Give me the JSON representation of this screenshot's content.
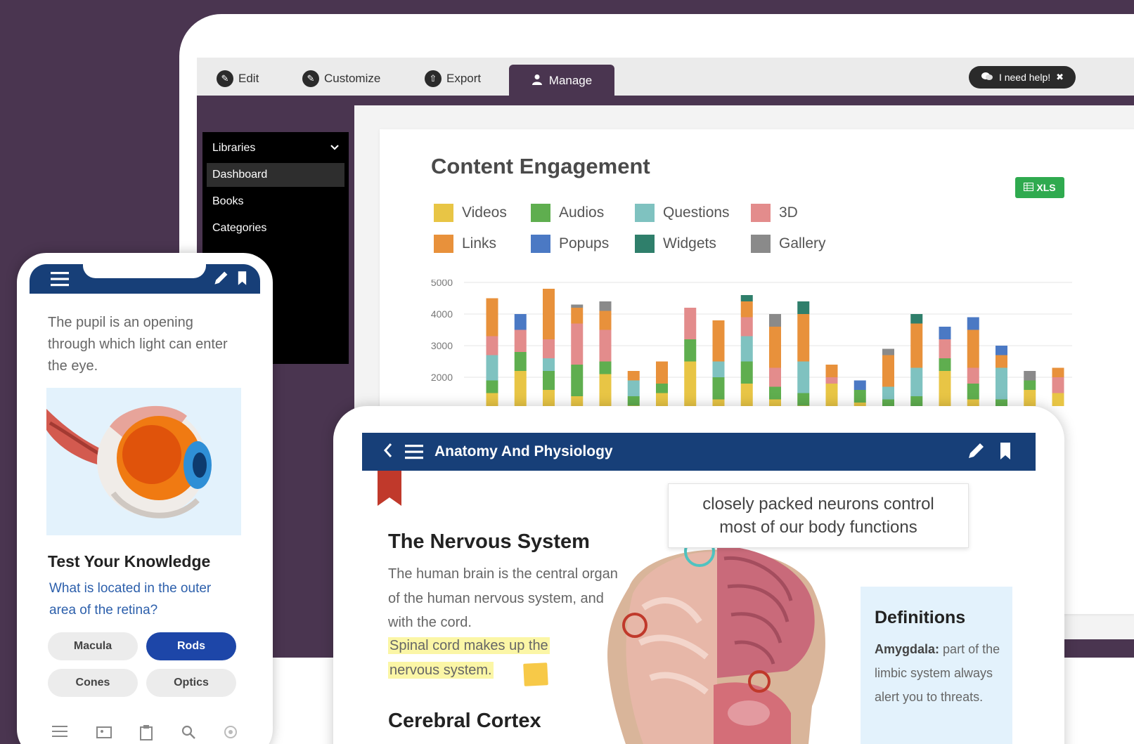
{
  "toolbar": {
    "edit_label": "Edit",
    "customize_label": "Customize",
    "export_label": "Export",
    "manage_label": "Manage",
    "help_label": "I need help!"
  },
  "sidebar": {
    "header": "Libraries",
    "items": [
      {
        "label": "Dashboard",
        "active": true
      },
      {
        "label": "Books",
        "active": false
      },
      {
        "label": "Categories",
        "active": false
      }
    ]
  },
  "dashboard": {
    "xls_label": "XLS"
  },
  "colors": {
    "primary_blue": "#173f78",
    "background_purple": "#4a3550",
    "selected_option": "#1d46a8",
    "xls_green": "#2faa4f"
  },
  "chart_data": {
    "type": "bar",
    "stacked": true,
    "title": "Content Engagement",
    "yticks": [
      2000,
      3000,
      4000,
      5000
    ],
    "ylim": [
      1500,
      5000
    ],
    "legend_position": "top-left",
    "series": [
      {
        "name": "Videos",
        "color": "#e8c545"
      },
      {
        "name": "Audios",
        "color": "#5fae4f"
      },
      {
        "name": "Questions",
        "color": "#7fc2c0"
      },
      {
        "name": "3D",
        "color": "#e38c8c"
      },
      {
        "name": "Links",
        "color": "#e8913b"
      },
      {
        "name": "Popups",
        "color": "#4b79c4"
      },
      {
        "name": "Widgets",
        "color": "#2f7f6b"
      },
      {
        "name": "Gallery",
        "color": "#8a8a8a"
      }
    ],
    "bars": [
      {
        "Videos": 500,
        "Audios": 400,
        "Questions": 800,
        "3D": 600,
        "Links": 1200
      },
      {
        "Videos": 1200,
        "Audios": 600,
        "3D": 700,
        "Popups": 500
      },
      {
        "Videos": 600,
        "Audios": 600,
        "Questions": 400,
        "3D": 600,
        "Links": 1600
      },
      {
        "Videos": 400,
        "Audios": 1000,
        "3D": 1300,
        "Links": 500,
        "Gallery": 100
      },
      {
        "Videos": 1100,
        "Audios": 400,
        "3D": 1000,
        "Links": 600,
        "Gallery": 300
      },
      {
        "Videos": 100,
        "Audios": 300,
        "Questions": 500,
        "Links": 300
      },
      {
        "Videos": 500,
        "Audios": 300,
        "Links": 700
      },
      {
        "Videos": 1500,
        "Audios": 700,
        "3D": 1000
      },
      {
        "Videos": 300,
        "Audios": 700,
        "Questions": 500,
        "Links": 1300
      },
      {
        "Videos": 800,
        "Audios": 700,
        "Questions": 800,
        "3D": 600,
        "Links": 500,
        "Widgets": 200
      },
      {
        "Videos": 300,
        "Audios": 400,
        "3D": 600,
        "Links": 1300,
        "Gallery": 400
      },
      {
        "Videos": 100,
        "Audios": 400,
        "Questions": 1000,
        "Links": 1500,
        "Widgets": 400
      },
      {
        "Videos": 800,
        "3D": 200,
        "Links": 400
      },
      {
        "Videos": 200,
        "Audios": 400,
        "Popups": 300
      },
      {
        "Audios": 300,
        "Questions": 400,
        "Links": 1000,
        "Gallery": 200
      },
      {
        "Audios": 400,
        "Questions": 900,
        "Links": 1400,
        "Widgets": 300
      },
      {
        "Videos": 1200,
        "Audios": 400,
        "3D": 600,
        "Popups": 400
      },
      {
        "Videos": 300,
        "Audios": 500,
        "3D": 500,
        "Links": 1200,
        "Popups": 400
      },
      {
        "Audios": 300,
        "Questions": 1000,
        "Links": 400,
        "Popups": 300
      },
      {
        "Videos": 600,
        "Audios": 300,
        "Gallery": 300
      },
      {
        "Videos": 500,
        "3D": 500,
        "Links": 300
      }
    ]
  },
  "tablet": {
    "title": "Anatomy And Physiology",
    "callout": [
      "closely packed neurons control",
      "most of our body functions"
    ],
    "section1_title": "The Nervous System",
    "section1_body": "The human brain is the central organ of the human nervous system, and with the cord.",
    "highlight_line1": "Spinal cord makes up the",
    "highlight_line2": "nervous system.",
    "section2_title": "Cerebral Cortex",
    "definitions_title": "Definitions",
    "definition_term": "Amygdala:",
    "definition_text": "part of the limbic system always alert you to threats."
  },
  "phone": {
    "intro_text": "The pupil is an opening through which light can enter the eye.",
    "quiz_title": "Test Your Knowledge",
    "quiz_question": "What is located in the outer area of the retina?",
    "options": [
      {
        "label": "Macula",
        "selected": false
      },
      {
        "label": "Rods",
        "selected": true
      },
      {
        "label": "Cones",
        "selected": false
      },
      {
        "label": "Optics",
        "selected": false
      }
    ]
  }
}
